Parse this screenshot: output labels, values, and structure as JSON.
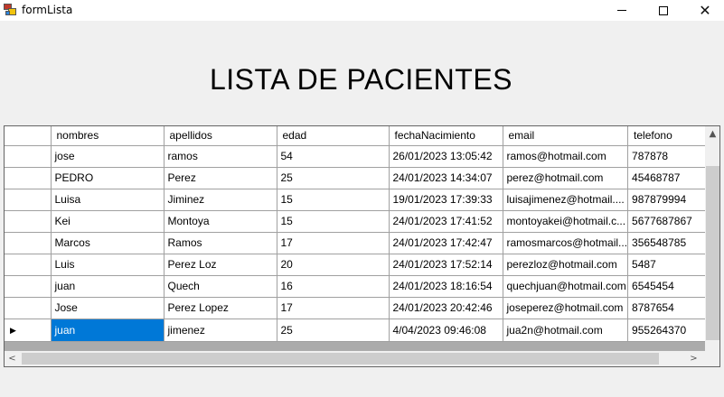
{
  "window": {
    "title": "formLista",
    "minimize_icon": "minimize-icon",
    "maximize_icon": "maximize-icon",
    "close_icon": "close-icon"
  },
  "page": {
    "title": "LISTA DE PACIENTES"
  },
  "grid": {
    "columns": [
      "nombres",
      "apellidos",
      "edad",
      "fechaNacimiento",
      "email",
      "telefono"
    ],
    "rows": [
      [
        "jose",
        "ramos",
        "54",
        "26/01/2023 13:05:42",
        "ramos@hotmail.com",
        "787878"
      ],
      [
        "PEDRO",
        "Perez",
        "25",
        "24/01/2023 14:34:07",
        "perez@hotmail.com",
        "45468787"
      ],
      [
        "Luisa",
        "Jiminez",
        "15",
        "19/01/2023 17:39:33",
        "luisajimenez@hotmail....",
        "987879994"
      ],
      [
        "Kei",
        "Montoya",
        "15",
        "24/01/2023 17:41:52",
        "montoyakei@hotmail.c...",
        "5677687867"
      ],
      [
        "Marcos",
        "Ramos",
        "17",
        "24/01/2023 17:42:47",
        "ramosmarcos@hotmail...",
        "356548785"
      ],
      [
        "Luis",
        "Perez Loz",
        "20",
        "24/01/2023 17:52:14",
        "perezloz@hotmail.com",
        "5487"
      ],
      [
        "juan",
        "Quech",
        "16",
        "24/01/2023 18:16:54",
        "quechjuan@hotmail.com",
        "6545454"
      ],
      [
        "Jose",
        "Perez Lopez",
        "17",
        "24/01/2023 20:42:46",
        "joseperez@hotmail.com",
        "8787654"
      ],
      [
        "juan",
        "jimenez",
        "25",
        "4/04/2023 09:46:08",
        "jua2n@hotmail.com",
        "955264370"
      ]
    ],
    "current_row_indicator": "▶",
    "selection_color": "#0078d7"
  },
  "scrollbars": {
    "up_arrow": "▲",
    "left_arrow": "<",
    "right_arrow": ">"
  }
}
